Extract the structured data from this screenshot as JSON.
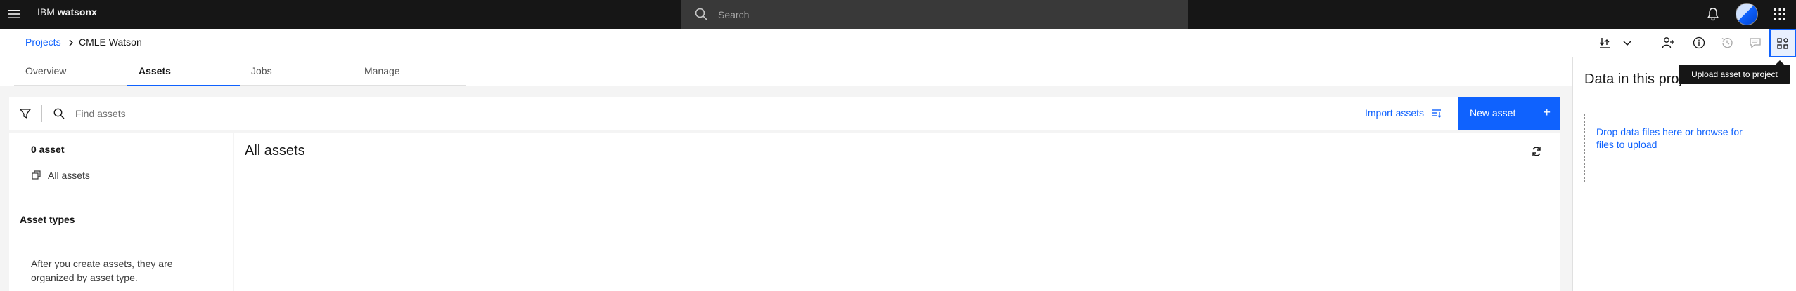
{
  "header": {
    "brand_prefix": "IBM",
    "brand_name": "watsonx",
    "search_placeholder": "Search"
  },
  "breadcrumb": {
    "parent": "Projects",
    "current": "CMLE Watson"
  },
  "toolbar": {
    "tooltip": "Upload asset to project"
  },
  "tabs": [
    {
      "label": "Overview"
    },
    {
      "label": "Assets"
    },
    {
      "label": "Jobs"
    },
    {
      "label": "Manage"
    }
  ],
  "filterbar": {
    "find_placeholder": "Find assets",
    "import_label": "Import assets",
    "new_asset_label": "New asset"
  },
  "leftpanel": {
    "count_label": "0 asset",
    "all_assets_label": "All assets",
    "asset_types_heading": "Asset types",
    "asset_types_note": "After you create assets, they are organized by asset type."
  },
  "content": {
    "title": "All assets"
  },
  "sidepanel": {
    "title": "Data in this project",
    "dropzone_text": "Drop data files here or browse for files to upload"
  },
  "colors": {
    "header_bg": "#161616",
    "accent": "#0f62fe",
    "work_bg": "#f4f4f4"
  }
}
